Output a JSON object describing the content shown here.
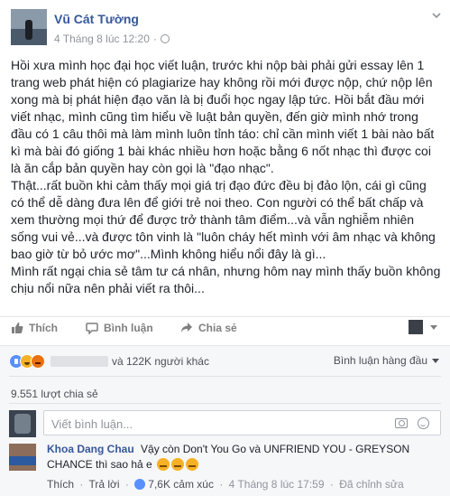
{
  "post": {
    "author": "Vũ Cát Tường",
    "timestamp": "4 Tháng 8 lúc 12:20",
    "separator": "·",
    "paragraphs": [
      "Hồi xưa mình học đại học viết luận, trước khi nộp bài phải gửi essay lên 1 trang web phát hiện có plagiarize hay không rồi mới được nộp, chứ nộp lên xong mà bị phát hiện đạo văn là bị đuổi học ngay lập tức. Hồi bắt đầu mới viết nhạc, mình cũng tìm hiểu về luật bản quyền, đến giờ mình nhớ trong đầu có 1 câu thôi mà làm mình luôn tỉnh táo: chỉ cần mình viết 1 bài nào bất kì mà bài đó giống 1 bài khác nhiều hơn hoặc bằng 6 nốt nhạc thì được coi là ăn cắp bản quyền hay còn gọi là \"đạo nhạc\".",
      "Thật...rất buồn khi cảm thấy mọi giá trị đạo đức đều bị đảo lộn, cái gì cũng có thể dễ dàng đưa lên để giới trẻ noi theo. Con người có thể bất chấp và xem thường mọi thứ để được trở thành tâm điểm...và vẫn nghiễm nhiên sống vui vẻ...và được tôn vinh là \"luôn cháy hết mình với âm nhạc và không bao giờ từ bỏ ước mơ\"...Mình không hiểu nổi đây là gì...",
      "Mình rất ngại chia sẻ tâm tư cá nhân, nhưng hôm nay mình thấy buồn không chịu nổi nữa nên phải viết ra thôi..."
    ]
  },
  "actions": {
    "like": "Thích",
    "comment": "Bình luận",
    "share": "Chia sẻ"
  },
  "reactions": {
    "summary": "và 122K người khác",
    "sort_label": "Bình luận hàng đầu"
  },
  "shares": {
    "label": "9.551 lượt chia sẻ"
  },
  "composer": {
    "placeholder": "Viết bình luận..."
  },
  "comment": {
    "author": "Khoa Dang Chau",
    "text": "Vậy còn Don't You Go và UNFRIEND YOU - GREYSON CHANCE thì sao hả e",
    "like": "Thích",
    "reply": "Trả lời",
    "reactions": "7,6K cảm xúc",
    "time": "4 Tháng 8 lúc 17:59",
    "edited": "Đã chỉnh sửa",
    "dot": "·"
  },
  "colors": {
    "link": "#365899",
    "meta": "#90949c",
    "like_reaction": "#5890ff",
    "haha_reaction": "#f7b125",
    "angry_reaction": "#e9710f"
  },
  "icons": [
    "globe-icon",
    "chevron-down-icon",
    "like-icon",
    "comment-icon",
    "share-icon",
    "camera-icon",
    "smiley-icon"
  ]
}
